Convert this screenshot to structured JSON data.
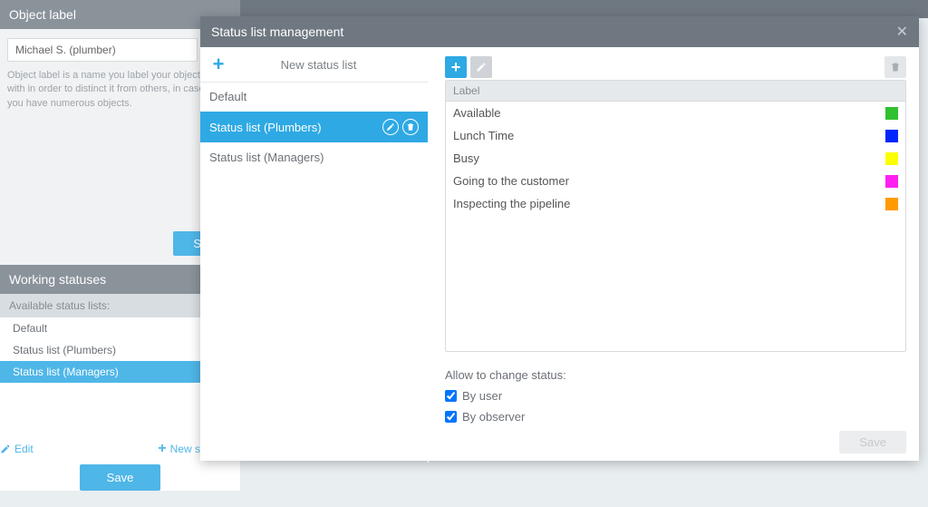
{
  "left_panel": {
    "title": "Object label",
    "input_value": "Michael S. (plumber)",
    "help_text": "Object label is a name you label your object with in order to distinct it from others, in case you have numerous objects.",
    "save_ghost": "Save"
  },
  "working": {
    "title": "Working statuses",
    "subtitle": "Available status lists:",
    "items": [
      {
        "label": "Default",
        "active": false
      },
      {
        "label": "Status list (Plumbers)",
        "active": false
      },
      {
        "label": "Status list (Managers)",
        "active": true
      }
    ],
    "edit": "Edit",
    "new": "New status list",
    "save": "Save"
  },
  "modal": {
    "title": "Status list management",
    "new_label": "New status list",
    "left_items": [
      {
        "label": "Default",
        "selected": false
      },
      {
        "label": "Status list (Plumbers)",
        "selected": true
      },
      {
        "label": "Status list (Managers)",
        "selected": false
      }
    ],
    "col_header": "Label",
    "statuses": [
      {
        "label": "Available",
        "color": "#2fc12f"
      },
      {
        "label": "Lunch Time",
        "color": "#0025ff"
      },
      {
        "label": "Busy",
        "color": "#fbff00"
      },
      {
        "label": "Going to the customer",
        "color": "#ff1ff1"
      },
      {
        "label": "Inspecting the pipeline",
        "color": "#ff9a00"
      }
    ],
    "allow_label": "Allow to change status:",
    "chk1": "By user",
    "chk2": "By observer",
    "save": "Save"
  }
}
